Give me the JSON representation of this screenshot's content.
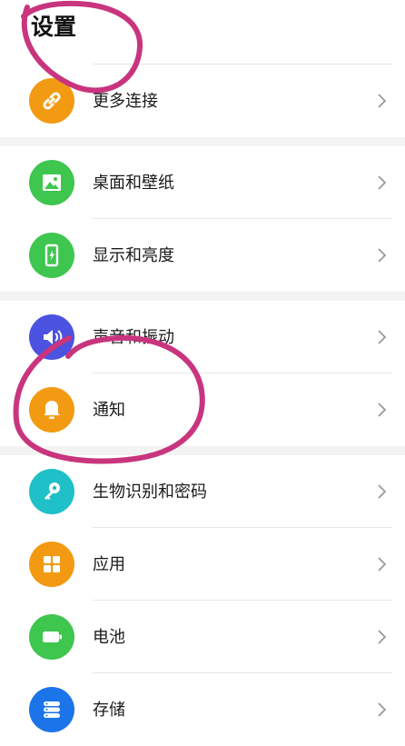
{
  "header": {
    "title": "设置"
  },
  "colors": {
    "orange": "#f29a12",
    "green": "#3ec64f",
    "indigo": "#4b53e0",
    "teal": "#1fc0c7",
    "blue": "#1b74e8",
    "marker": "#c8357e"
  },
  "items": [
    {
      "label": "更多连接",
      "icon": "link-icon"
    },
    {
      "label": "桌面和壁纸",
      "icon": "image-icon"
    },
    {
      "label": "显示和亮度",
      "icon": "brightness-icon"
    },
    {
      "label": "声音和振动",
      "icon": "speaker-icon"
    },
    {
      "label": "通知",
      "icon": "bell-icon"
    },
    {
      "label": "生物识别和密码",
      "icon": "key-icon"
    },
    {
      "label": "应用",
      "icon": "apps-grid-icon"
    },
    {
      "label": "电池",
      "icon": "battery-icon"
    },
    {
      "label": "存储",
      "icon": "storage-icon"
    }
  ]
}
